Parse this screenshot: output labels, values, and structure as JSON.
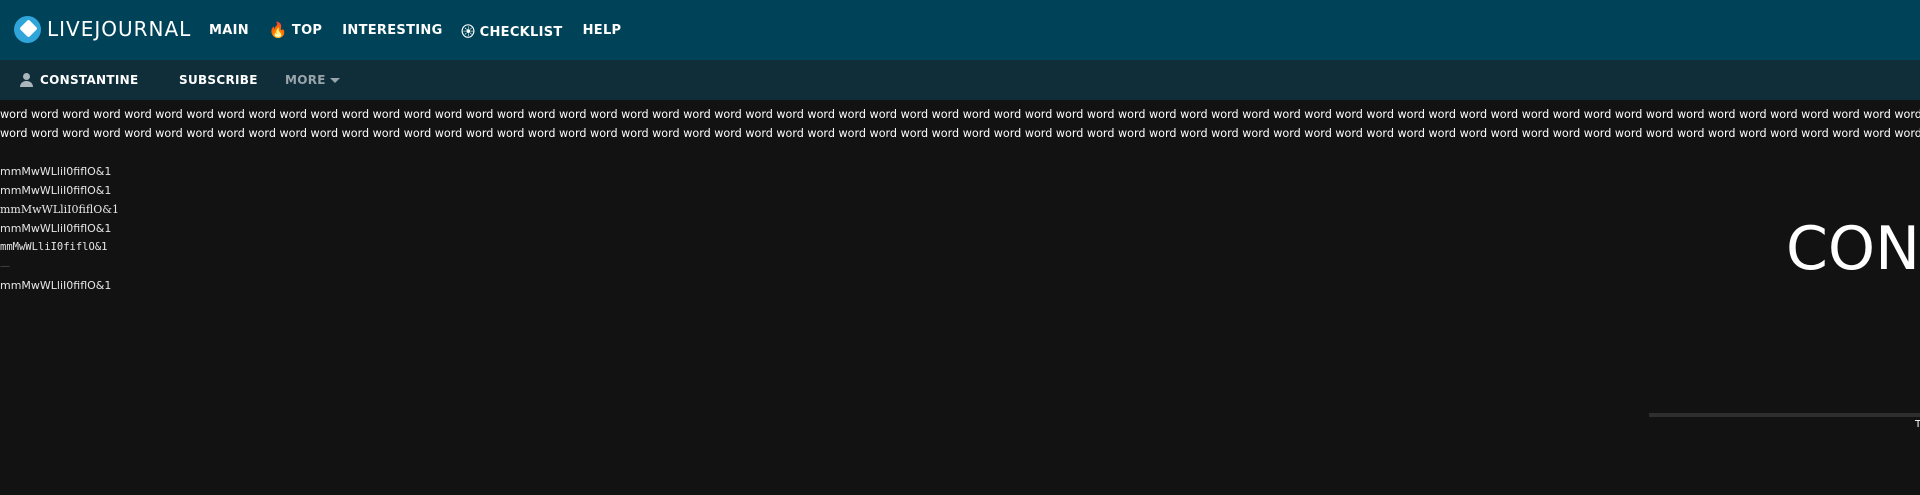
{
  "header": {
    "logo_text": "LIVEJOURNAL",
    "nav": [
      {
        "label": "MAIN"
      },
      {
        "label": "TOP",
        "icon": "fire-icon"
      },
      {
        "label": "INTERESTING"
      },
      {
        "label": "☀︎⃝⃝ CHECKLIST"
      },
      {
        "label": "HELP"
      }
    ]
  },
  "subnav": {
    "user_label": "CONSTANTINE",
    "subscribe_label": "SUBSCRIBE",
    "more_label": "MORE"
  },
  "content": {
    "word_line_1": "word word word word word word word word word word word word word word word word word word word word word word word word word word word word word word word word word word word word word word word word word word word word word word word word word word word word word word word word word word word word word word word word word word word word",
    "word_line_2": "word word word word word word word word word word word word word word word word word word word word word word word word word word word word word word word word word word word word word word word word word word word word word word word word word word word word word word word word word word word word word word word word word word word word word",
    "samples": [
      "mmMwWLliI0fiflO&1",
      "mmMwWLliI0fiflO&1",
      "mmMwWLliI0fiflO&1",
      "mmMwWLliI0fiflO&1",
      "mmMwWLliI0fiflO&1",
      "—",
      "mmMwWLliI0fiflO&1"
    ],
    "big_title": "CON",
    "tiny_text": "T"
  },
  "colors": {
    "header_bg": "#004359",
    "subnav_bg": "#0f2e3a",
    "page_bg": "#121212",
    "logo_accent": "#2fa5da"
  }
}
